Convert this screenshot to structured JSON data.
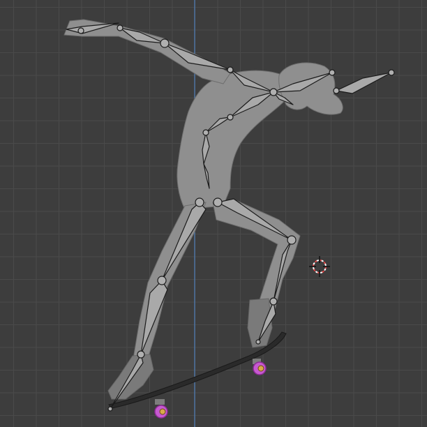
{
  "viewport": {
    "background_color": "#3d3d3d",
    "grid_color": "#4a4a4a",
    "axis_line_color": "#4f7fb8"
  },
  "scene": {
    "mesh_color": "#8f8f8f",
    "armature_bone_color": "#a9a9a9",
    "armature_outline_color": "#1b1b1b",
    "wheel_color": "#c65ad0",
    "cursor_icon": "3d-cursor-icon"
  }
}
